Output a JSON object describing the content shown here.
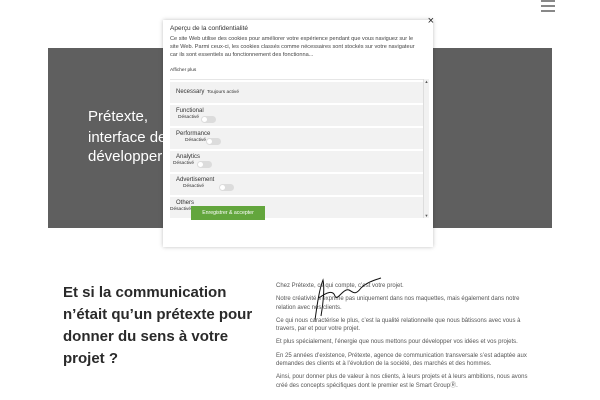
{
  "hero": {
    "line1": "Prétexte,",
    "line2": "interface de",
    "line3": "développer"
  },
  "cookie_modal": {
    "close_symbol": "×",
    "title": "Aperçu de la confidentialité",
    "description": "Ce site Web utilise des cookies pour améliorer votre expérience pendant que vous naviguez sur le site Web. Parmi ceux-ci, les cookies classés comme nécessaires sont stockés sur votre navigateur car ils sont essentiels au fonctionnement des fonctionna...",
    "show_more": "Afficher plus",
    "categories": [
      {
        "name": "Necessary",
        "status": "Toujours activé"
      },
      {
        "name": "Functional",
        "status": "Désactivé"
      },
      {
        "name": "Performance",
        "status": "Désactivé"
      },
      {
        "name": "Analytics",
        "status": "Désactivé"
      },
      {
        "name": "Advertisement",
        "status": "Désactivé"
      },
      {
        "name": "Others",
        "status": "Désactivé"
      }
    ],
    "save_label": "Enregistrer & accepter"
  },
  "section": {
    "headline": "Et si la communication n’était qu’un prétexte pour donner du sens à votre projet ?",
    "paragraphs": [
      "Chez Prétexte, ce qui compte, c’est votre projet.",
      "Notre créativité s’exprime pas uniquement dans nos maquettes, mais également dans notre relation avec nos clients.",
      "Ce qui nous caractérise le plus, c’est la qualité relationnelle que nous bâtissons avec vous à travers, par et pour votre projet.",
      "Et plus spécialement, l’énergie que nous mettons pour développer vos idées et vos projets.",
      "En 25 années d’existence, Prétexte, agence de communication transversale s’est adaptée aux demandes des clients et à l’évolution de la société, des marchés et des hommes.",
      "Ainsi, pour donner plus de valeur à nos clients, à leurs projets et à leurs ambitions, nous avons créé des concepts spécifiques dont le premier est le Smart GroupⓇ."
    ]
  },
  "colors": {
    "hero_bg": "#5f5f5f",
    "accent_green": "#63a63d"
  }
}
